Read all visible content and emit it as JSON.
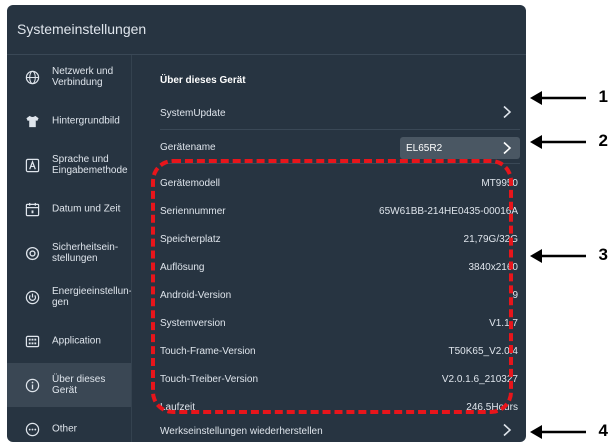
{
  "window": {
    "title": "Systemeinstellungen"
  },
  "sidebar": {
    "items": [
      {
        "label": "Netzwerk und Verbindung",
        "icon": "globe-icon",
        "active": false
      },
      {
        "label": "Hintergrundbild",
        "icon": "shirt-icon",
        "active": false
      },
      {
        "label": "Sprache und Eingabemethode",
        "icon": "keyboard-a-icon",
        "active": false
      },
      {
        "label": "Datum und Zeit",
        "icon": "calendar-icon",
        "active": false
      },
      {
        "label": "Sicherheitsein-stellungen",
        "icon": "shield-icon",
        "active": false
      },
      {
        "label": "Energieeinstellun-gen",
        "icon": "power-icon",
        "active": false
      },
      {
        "label": "Application",
        "icon": "app-grid-icon",
        "active": false
      },
      {
        "label": "Über dieses Gerät",
        "icon": "info-icon",
        "active": true
      },
      {
        "label": "Other",
        "icon": "more-icon",
        "active": false
      }
    ]
  },
  "main": {
    "section_title": "Über dieses Gerät",
    "system_update": {
      "label": "SystemUpdate"
    },
    "device_name": {
      "label": "Gerätename",
      "value": "EL65R2"
    },
    "info_rows": [
      {
        "label": "Gerätemodell",
        "value": "MT9950"
      },
      {
        "label": "Seriennummer",
        "value": "65W61BB-214HE0435-00016A"
      },
      {
        "label": "Speicherplatz",
        "value": "21,79G/32G"
      },
      {
        "label": "Auflösung",
        "value": "3840x2160"
      },
      {
        "label": "Android-Version",
        "value": "9"
      },
      {
        "label": "Systemversion",
        "value": "V1.1.7"
      },
      {
        "label": "Touch-Frame-Version",
        "value": "T50K65_V2.0.4"
      },
      {
        "label": "Touch-Treiber-Version",
        "value": "V2.0.1.6_210327"
      },
      {
        "label": "Laufzeit",
        "value": "246.5Hours"
      }
    ],
    "factory_reset": {
      "label": "Werkseinstellungen wiederherstellen"
    }
  },
  "annotations": {
    "markers": [
      "1",
      "2",
      "3",
      "4"
    ],
    "highlight_color": "#e8151b"
  }
}
